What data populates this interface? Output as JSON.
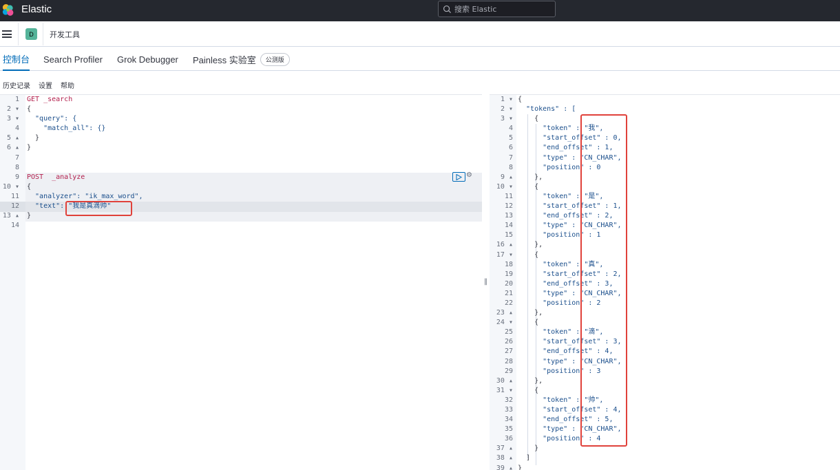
{
  "header": {
    "app_title": "Elastic",
    "search_placeholder": "搜索 Elastic"
  },
  "nav": {
    "space_initial": "D",
    "breadcrumb": "开发工具"
  },
  "tabs": [
    {
      "label": "控制台",
      "active": true
    },
    {
      "label": "Search Profiler",
      "active": false
    },
    {
      "label": "Grok Debugger",
      "active": false
    },
    {
      "label": "Painless 实验室",
      "active": false,
      "badge": "公测版"
    }
  ],
  "toolbar": {
    "history": "历史记录",
    "settings": "设置",
    "help": "帮助"
  },
  "request_editor": {
    "lines": [
      "GET _search",
      "{",
      "  \"query\": {",
      "    \"match_all\": {}",
      "  }",
      "}",
      "",
      "",
      "POST  _analyze",
      "{",
      "  \"analyzer\": \"ik_max_word\",",
      "  \"text\": \"我是真滴帅\"",
      "}",
      ""
    ]
  },
  "response_editor": {
    "lines": [
      "{",
      "  \"tokens\" : [",
      "    {",
      "      \"token\" : \"我\",",
      "      \"start_offset\" : 0,",
      "      \"end_offset\" : 1,",
      "      \"type\" : \"CN_CHAR\",",
      "      \"position\" : 0",
      "    },",
      "    {",
      "      \"token\" : \"是\",",
      "      \"start_offset\" : 1,",
      "      \"end_offset\" : 2,",
      "      \"type\" : \"CN_CHAR\",",
      "      \"position\" : 1",
      "    },",
      "    {",
      "      \"token\" : \"真\",",
      "      \"start_offset\" : 2,",
      "      \"end_offset\" : 3,",
      "      \"type\" : \"CN_CHAR\",",
      "      \"position\" : 2",
      "    },",
      "    {",
      "      \"token\" : \"滴\",",
      "      \"start_offset\" : 3,",
      "      \"end_offset\" : 4,",
      "      \"type\" : \"CN_CHAR\",",
      "      \"position\" : 3",
      "    },",
      "    {",
      "      \"token\" : \"帅\",",
      "      \"start_offset\" : 4,",
      "      \"end_offset\" : 5,",
      "      \"type\" : \"CN_CHAR\",",
      "      \"position\" : 4",
      "    }",
      "  ]",
      "}"
    ]
  },
  "colors": {
    "accent": "#006bb8",
    "annotation": "#e0413a",
    "topbar": "#25282f"
  }
}
